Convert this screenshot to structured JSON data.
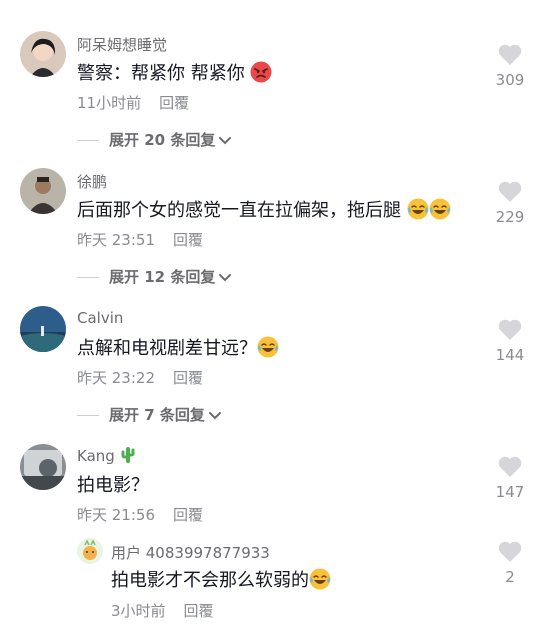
{
  "comments": [
    {
      "username": "阿呆姆想睡觉",
      "text": "警察：帮紧你 帮紧你",
      "emoji": "angry-face",
      "time": "11小时前",
      "reply": "回覆",
      "likes": "309",
      "expand": "展开 20 条回复"
    },
    {
      "username": "徐鹏",
      "text": "后面那个女的感觉一直在拉偏架，拖后腿",
      "emoji": "laughing-tears x2",
      "time": "昨天 23:51",
      "reply": "回覆",
      "likes": "229",
      "expand": "展开 12 条回复"
    },
    {
      "username": "Calvin",
      "text": "点解和电视剧差甘远？",
      "emoji": "laughing-tears",
      "time": "昨天 23:22",
      "reply": "回覆",
      "likes": "144",
      "expand": "展开 7 条回复"
    },
    {
      "username": "Kang",
      "username_emoji": "cactus",
      "text": "拍电影？",
      "time": "昨天 21:56",
      "reply": "回覆",
      "likes": "147"
    }
  ],
  "sub_reply": {
    "username": "用户 4083997877933",
    "text": "拍电影才不会那么软弱的",
    "emoji": "laughing-tears",
    "time": "3小时前",
    "reply": "回覆",
    "likes": "2"
  },
  "colors": {
    "text": "#161823",
    "secondary": "#8a8b91",
    "username": "#6b6b70",
    "heart": "#d6d6da"
  }
}
